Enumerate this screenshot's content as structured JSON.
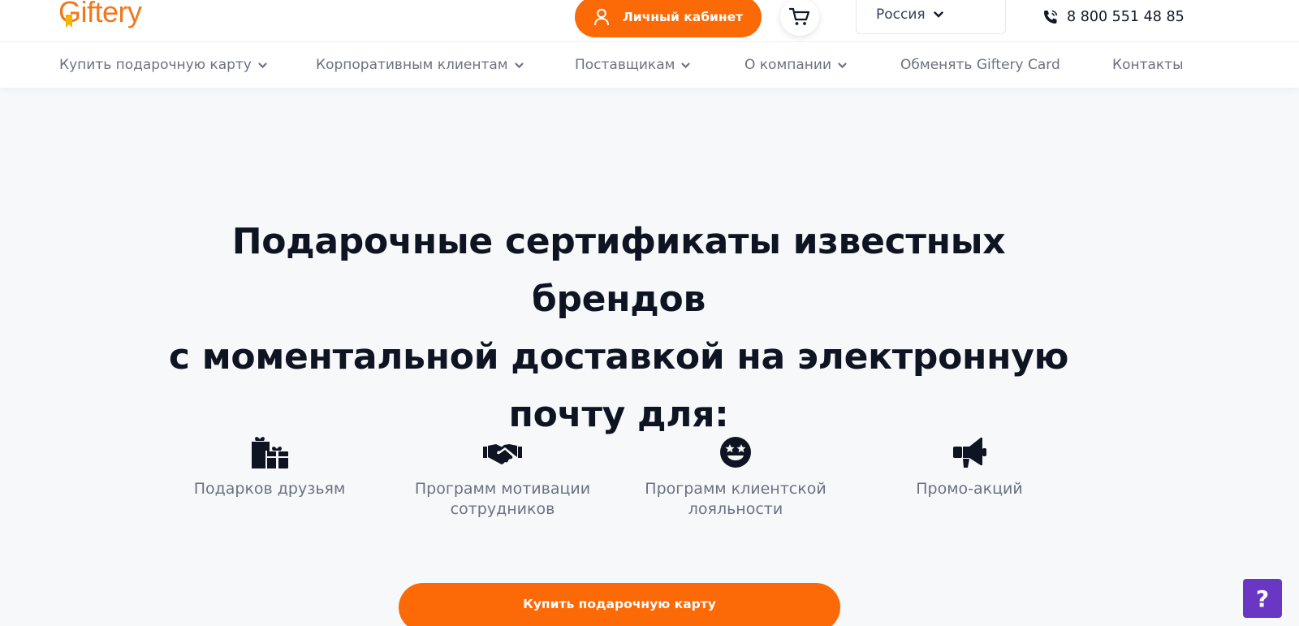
{
  "brand": {
    "logo_text": "Giftery",
    "accent": "#fb6a07",
    "help_accent": "#6a36c4"
  },
  "header": {
    "cabinet_label": "Личный кабинет",
    "cabinet_icon": "user-icon",
    "cart_icon": "cart-icon",
    "country": "Россия",
    "phone": "8 800 551 48 85",
    "phone_icon": "phone-icon"
  },
  "nav": {
    "items": [
      {
        "label": "Купить подарочную карту",
        "has_dropdown": true
      },
      {
        "label": "Корпоративным клиентам",
        "has_dropdown": true
      },
      {
        "label": "Поставщикам",
        "has_dropdown": true
      },
      {
        "label": "О компании",
        "has_dropdown": true
      },
      {
        "label": "Обменять Giftery Card",
        "has_dropdown": false
      },
      {
        "label": "Контакты",
        "has_dropdown": false
      }
    ]
  },
  "hero": {
    "title_lines": [
      "Подарочные сертификаты известных брендов",
      "с моментальной доставкой на электронную",
      "почту для:"
    ]
  },
  "features": [
    {
      "icon": "gifts-icon",
      "label_lines": [
        "Подарков друзьям"
      ]
    },
    {
      "icon": "handshake-icon",
      "label_lines": [
        "Программ мотивации",
        "сотрудников"
      ]
    },
    {
      "icon": "star-eyes-smile-icon",
      "label_lines": [
        "Программ клиентской",
        "лояльности"
      ]
    },
    {
      "icon": "megaphone-icon",
      "label_lines": [
        "Промо-акций"
      ]
    }
  ],
  "cta": {
    "buy_label": "Купить подарочную карту"
  },
  "help": {
    "label": "?"
  }
}
